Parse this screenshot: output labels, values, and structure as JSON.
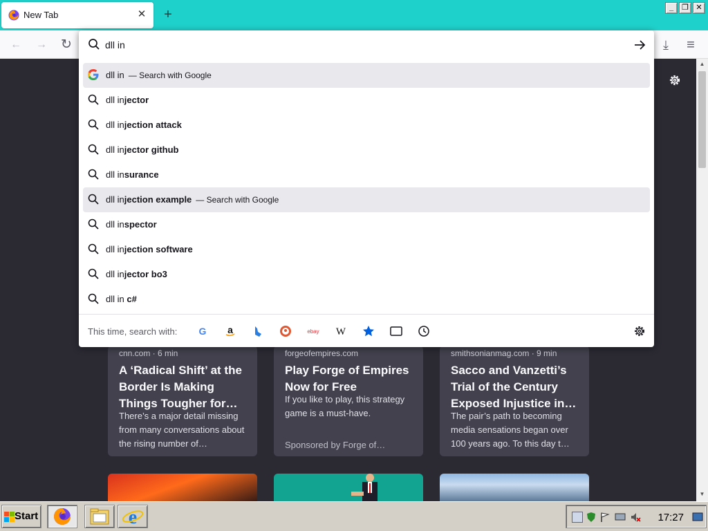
{
  "window": {
    "tab_title": "New Tab",
    "tab_close": "✕",
    "new_tab": "+",
    "minimize": "_",
    "restore": "❐",
    "close": "✕"
  },
  "nav": {
    "back": "←",
    "forward": "→",
    "reload": "↻",
    "downloads": "⤓",
    "menu": "≡"
  },
  "urlbar": {
    "value": "dll in",
    "go": "→"
  },
  "suggestions": [
    {
      "typed": "dll in",
      "completion": "",
      "action": "— Search with Google",
      "icon": "google-icon",
      "highlighted": true
    },
    {
      "typed": "dll in",
      "completion": "jector",
      "action": "",
      "icon": "search-icon",
      "highlighted": false
    },
    {
      "typed": "dll in",
      "completion": "jection attack",
      "action": "",
      "icon": "search-icon",
      "highlighted": false
    },
    {
      "typed": "dll in",
      "completion": "jector github",
      "action": "",
      "icon": "search-icon",
      "highlighted": false
    },
    {
      "typed": "dll in",
      "completion": "surance",
      "action": "",
      "icon": "search-icon",
      "highlighted": false
    },
    {
      "typed": "dll in",
      "completion": "jection example",
      "action": "— Search with Google",
      "icon": "search-icon",
      "highlighted": true
    },
    {
      "typed": "dll in",
      "completion": "spector",
      "action": "",
      "icon": "search-icon",
      "highlighted": false
    },
    {
      "typed": "dll in",
      "completion": "jection software",
      "action": "",
      "icon": "search-icon",
      "highlighted": false
    },
    {
      "typed": "dll in",
      "completion": "jector bo3",
      "action": "",
      "icon": "search-icon",
      "highlighted": false
    },
    {
      "typed": "dll in ",
      "completion": "c#",
      "action": "",
      "icon": "search-icon",
      "highlighted": false
    }
  ],
  "one_offs": {
    "label": "This time, search with:",
    "engines": [
      "google-icon",
      "amazon-icon",
      "bing-icon",
      "duckduckgo-icon",
      "ebay-icon",
      "wikipedia-icon",
      "bookmarks-icon",
      "tabs-icon",
      "history-icon"
    ],
    "wikipedia_glyph": "W",
    "ebay_glyph": "ebay"
  },
  "cards": [
    {
      "source": "cnn.com · 6 min",
      "headline": "A ‘Radical Shift’ at the Border Is Making Things Tougher for…",
      "excerpt": "There’s a major detail missing from many conversations about the rising number of…",
      "sponsor": ""
    },
    {
      "source": "forgeofempires.com",
      "headline": "Play Forge of Empires Now for Free",
      "excerpt": "If you like to play, this strategy game is a must-have.",
      "sponsor": "Sponsored by Forge of…"
    },
    {
      "source": "smithsonianmag.com · 9 min",
      "headline": "Sacco and Vanzetti’s Trial of the Century Exposed Injustice in…",
      "excerpt": "The pair’s path to becoming media sensations began over 100 years ago. To this day t…",
      "sponsor": ""
    }
  ],
  "taskbar": {
    "start": "Start",
    "clock": "17:27"
  },
  "colors": {
    "accent": "#1fd1cb",
    "card_bg": "#42414d",
    "page_bg": "#2b2a33",
    "highlight": "#e9e9ed"
  }
}
